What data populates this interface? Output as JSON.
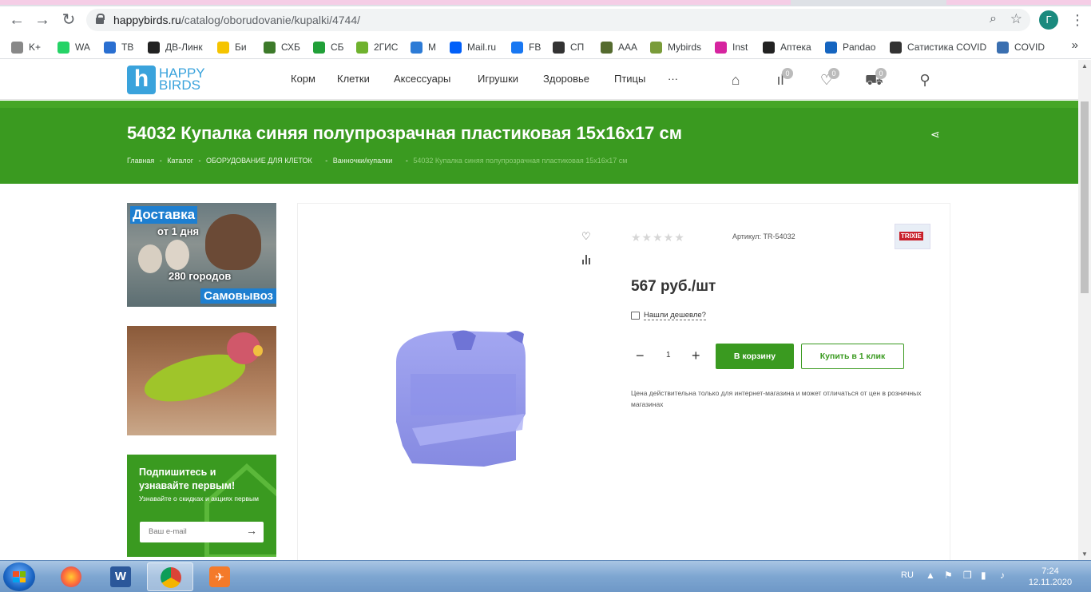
{
  "browser": {
    "url_host": "happybirds.ru",
    "url_path": "/catalog/oborudovanie/kupalki/4744/",
    "profile_initial": "Г",
    "bookmarks": [
      {
        "label": "K+",
        "color": "#888"
      },
      {
        "label": "WA",
        "color": "#25d366"
      },
      {
        "label": "ТВ",
        "color": "#2a6fd1"
      },
      {
        "label": "ДВ-Линк",
        "color": "#222"
      },
      {
        "label": "Би",
        "color": "#f5c400"
      },
      {
        "label": "СХБ",
        "color": "#3d7a2a"
      },
      {
        "label": "СБ",
        "color": "#21a038"
      },
      {
        "label": "2ГИС",
        "color": "#6fb22e"
      },
      {
        "label": "М",
        "color": "#2d7bd6"
      },
      {
        "label": "Mail.ru",
        "color": "#005ff9"
      },
      {
        "label": "FB",
        "color": "#1877f2"
      },
      {
        "label": "СП",
        "color": "#333"
      },
      {
        "label": "ААА",
        "color": "#556b2f"
      },
      {
        "label": "Mybirds",
        "color": "#7a9c3a"
      },
      {
        "label": "Inst",
        "color": "#d6249f"
      },
      {
        "label": "Аптека",
        "color": "#222"
      },
      {
        "label": "Pandao",
        "color": "#1565c0"
      },
      {
        "label": "Сатистика COVID",
        "color": "#333"
      },
      {
        "label": "COVID",
        "color": "#3a6fb0"
      }
    ]
  },
  "header": {
    "logo_line1": "HAPPY",
    "logo_line2": "BIRDS",
    "nav": [
      "Корм",
      "Клетки",
      "Аксессуары",
      "Игрушки",
      "Здоровье",
      "Птицы",
      "···"
    ],
    "compare_count": "0",
    "favorites_count": "0",
    "cart_count": "0"
  },
  "banner": {
    "title": "54032 Купалка синяя полупрозрачная пластиковая 15х16х17 см",
    "breadcrumb": [
      "Главная",
      "-",
      "Каталог",
      "-",
      "ОБОРУДОВАНИЕ ДЛЯ КЛЕТОК",
      "-",
      "Ванночки/купалки",
      "-"
    ],
    "breadcrumb_current": "54032 Купалка синяя полупрозрачная пластиковая 15х16х17 см"
  },
  "sidebar": {
    "promo1": {
      "line1": "Доставка",
      "line2": "от 1 дня",
      "line3": "280 городов",
      "line4": "Самовывоз"
    },
    "subscribe": {
      "heading": "Подпишитесь и узнавайте первым!",
      "subtext": "Узнавайте о скидках и акциях первым",
      "placeholder": "Ваш e-mail"
    }
  },
  "product": {
    "stars": "★★★★★",
    "rating": 0,
    "sku": "Артикул: TR-54032",
    "brand": "TRIXIE",
    "price": "567 руб./шт",
    "cheaper_link": "Нашли дешевле?",
    "quantity": "1",
    "add_to_cart": "В корзину",
    "buy_one_click": "Купить в 1 клик",
    "note": "Цена действительна только для интернет-магазина и может отличаться от цен в розничных магазинах"
  },
  "taskbar": {
    "lang": "RU",
    "time": "7:24",
    "date": "12.11.2020"
  }
}
